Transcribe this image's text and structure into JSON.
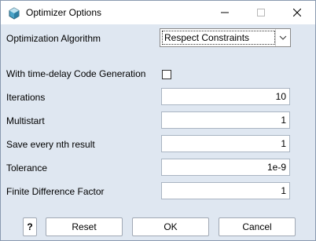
{
  "window": {
    "title": "Optimizer Options",
    "app_icon": "optimizer-app-icon",
    "controls": [
      "minimize-icon",
      "maximize-icon",
      "close-icon"
    ]
  },
  "form": {
    "algorithm_label": "Optimization Algorithm",
    "algorithm_value": "Respect Constraints",
    "time_delay_label": "With time-delay Code Generation",
    "time_delay_checked": false,
    "iterations_label": "Iterations",
    "iterations_value": "10",
    "multistart_label": "Multistart",
    "multistart_value": "1",
    "save_nth_label": "Save every nth result",
    "save_nth_value": "1",
    "tolerance_label": "Tolerance",
    "tolerance_value": "1e-9",
    "fdf_label": "Finite Difference Factor",
    "fdf_value": "1"
  },
  "buttons": {
    "help": "?",
    "reset": "Reset",
    "ok": "OK",
    "cancel": "Cancel"
  },
  "colors": {
    "dialog_bg": "#dfe7f1",
    "titlebar_bg": "#ffffff",
    "field_bg": "#ffffff"
  }
}
